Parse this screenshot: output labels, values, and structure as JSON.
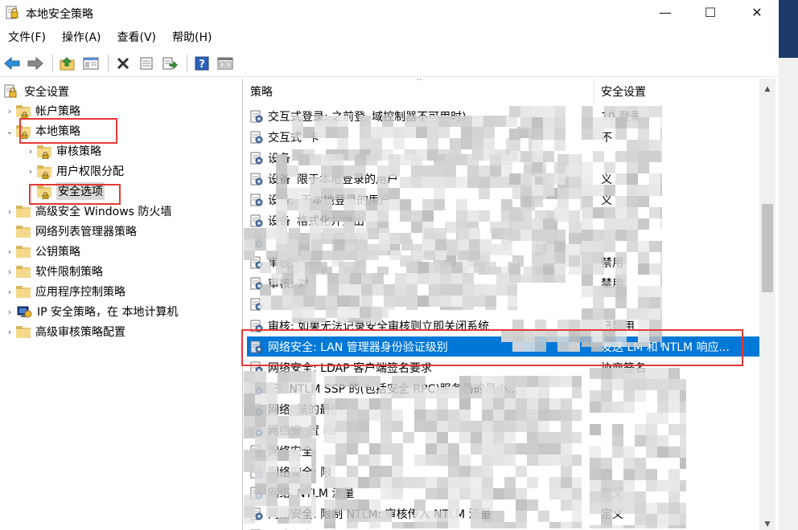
{
  "window": {
    "title": "本地安全策略",
    "controls": {
      "minimize": "—",
      "maximize": "☐",
      "close": "✕"
    }
  },
  "menu": [
    "文件(F)",
    "操作(A)",
    "查看(V)",
    "帮助(H)"
  ],
  "toolbar": [
    "back-icon",
    "forward-icon",
    "up-icon",
    "show-hide-tree-icon",
    "delete-icon",
    "properties-icon",
    "export-icon",
    "help-icon",
    "view-icon"
  ],
  "tree": {
    "root": "安全设置",
    "items": [
      {
        "label": "帐户策略",
        "expand": "›"
      },
      {
        "label": "本地策略",
        "expand": "⌄"
      },
      {
        "label": "审核策略",
        "expand": "›"
      },
      {
        "label": "用户权限分配",
        "expand": "›"
      },
      {
        "label": "安全选项",
        "expand": ""
      },
      {
        "label": "高级安全 Windows 防火墙",
        "expand": "›"
      },
      {
        "label": "网络列表管理器策略",
        "expand": ""
      },
      {
        "label": "公钥策略",
        "expand": "›"
      },
      {
        "label": "软件限制策略",
        "expand": "›"
      },
      {
        "label": "应用程序控制策略",
        "expand": "›"
      },
      {
        "label": "IP 安全策略，在 本地计算机",
        "expand": "›"
      },
      {
        "label": "高级审核策略配置",
        "expand": "›"
      }
    ]
  },
  "list": {
    "col_policy": "策略",
    "col_setting": "安全设置",
    "sort_caret": "^",
    "rows": [
      {
        "policy": "交互式登录: 之前登",
        "policy_tail": "域控制器不可用时)",
        "setting": "10 登录"
      },
      {
        "policy": "交互式",
        "policy_tail": "卡",
        "setting": "不"
      },
      {
        "policy": "设备",
        "policy_tail": "",
        "setting": ""
      },
      {
        "policy": "设备",
        "policy_tail": "限于本地登录的用户",
        "setting": "义"
      },
      {
        "policy": "设备:",
        "policy_tail": "于本地登录的用户",
        "setting": "义"
      },
      {
        "policy": "设备",
        "policy_tail": "格式化并弹出",
        "setting": ""
      },
      {
        "policy": "",
        "policy_tail": "",
        "setting": ""
      },
      {
        "policy": "审核:",
        "policy_tail": "",
        "setting": "禁用"
      },
      {
        "policy": "审核: 对",
        "policy_tail": "",
        "setting": "禁用"
      },
      {
        "policy": "",
        "policy_tail": "",
        "setting": ""
      },
      {
        "policy": "审核: 如果无法记录安全审核则立即关闭系统",
        "policy_tail": "",
        "setting": "已禁用"
      },
      {
        "policy": "网络安全: LAN 管理器身份验证级别",
        "policy_tail": "",
        "setting": "发送 LM 和 NTLM 响应..."
      },
      {
        "policy": "网络安全: LDAP 客户端签名要求",
        "policy_tail": "",
        "setting": "协商签名"
      },
      {
        "policy": "",
        "policy_tail": "于 NTLM SSP 的(包括安全 RPC)服务器的最小...",
        "setting": ""
      },
      {
        "policy": "网络",
        "policy_tail": "端的最小...",
        "setting": ""
      },
      {
        "policy": "网络安",
        "policy_tail": "置 Ke",
        "setting": ""
      },
      {
        "policy": "网络安全",
        "policy_tail": "",
        "setting": ""
      },
      {
        "policy": "网络安全: 限",
        "policy_tail": "",
        "setting": ""
      },
      {
        "policy": "网络",
        "policy_tail": "NTLM 流量",
        "setting": "定义"
      },
      {
        "policy": "网络安全: 限制 NTLM: 审核传入 NTLM 流量",
        "policy_tail": "",
        "setting": "定义"
      },
      {
        "policy": "网络安全: 限制",
        "policy_tail": "",
        "setting": ""
      }
    ]
  }
}
